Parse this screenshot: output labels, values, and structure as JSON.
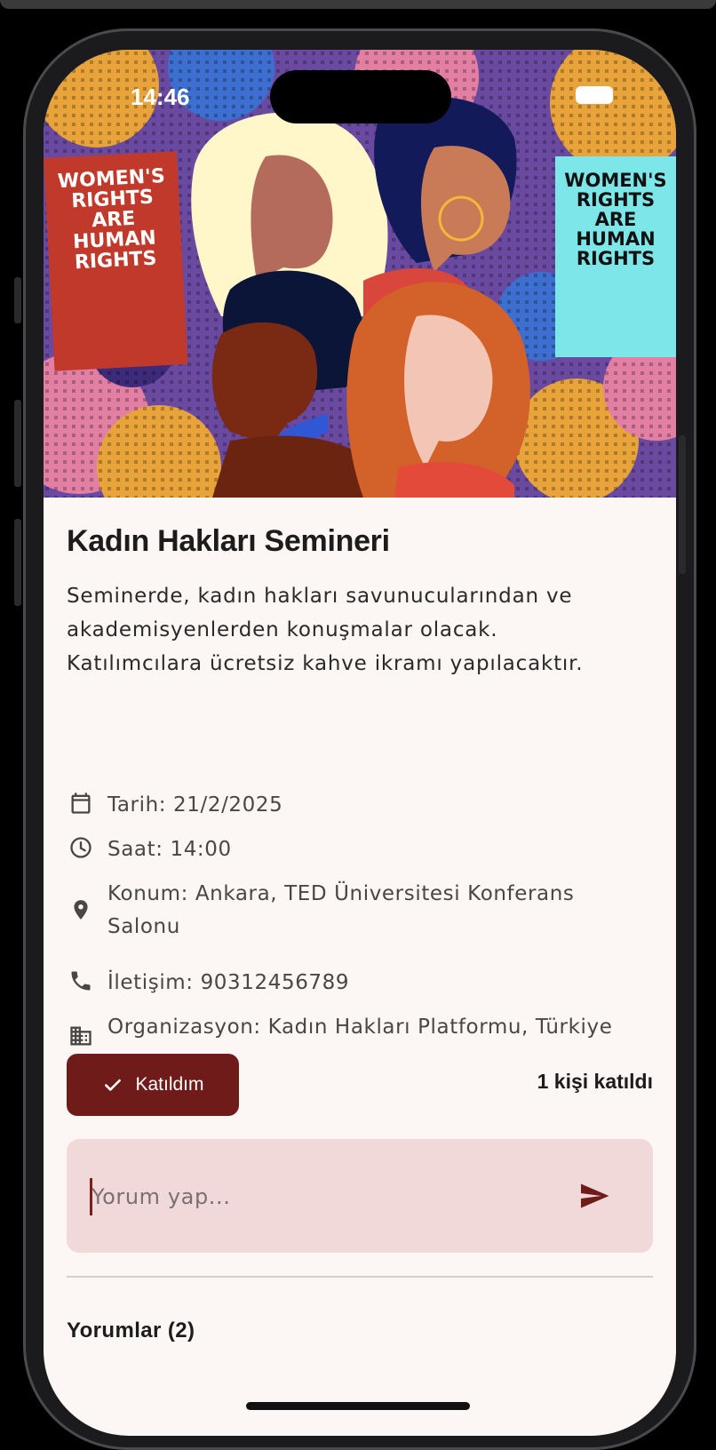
{
  "status_bar": {
    "time": "14:46"
  },
  "hero": {
    "banner_left_text": "WOMEN'S\nRIGHTS\nARE\nHUMAN\nRIGHTS",
    "banner_right_text": "WOMEN'S\nRIGHTS\nARE\nHUMAN\nRIGHTS"
  },
  "event": {
    "title": "Kadın Hakları Semineri",
    "description": "Seminerde, kadın hakları savunucularından ve akademisyenlerden konuşmalar olacak. Katılımcılara ücretsiz kahve ikramı yapılacaktır.",
    "date": "Tarih: 21/2/2025",
    "time": "Saat: 14:00",
    "location": "Konum:  Ankara, TED Üniversitesi Konferans Salonu",
    "contact": "İletişim: 90312456789",
    "organization": "Organizasyon:  Kadın Hakları Platformu, Türkiye"
  },
  "attend": {
    "button_label": "Katıldım",
    "count_text": "1 kişi katıldı"
  },
  "comment": {
    "placeholder": "Yorum yap..."
  },
  "comments": {
    "title": "Yorumlar (2)"
  },
  "colors": {
    "primary": "#6e1b1a",
    "comment_bg": "#f2d9d9",
    "page_bg": "#fcf7f5"
  },
  "icons": [
    "back-arrow-icon",
    "calendar-icon",
    "clock-icon",
    "location-pin-icon",
    "phone-icon",
    "building-icon",
    "check-icon",
    "send-icon",
    "wifi-icon",
    "battery-icon"
  ]
}
